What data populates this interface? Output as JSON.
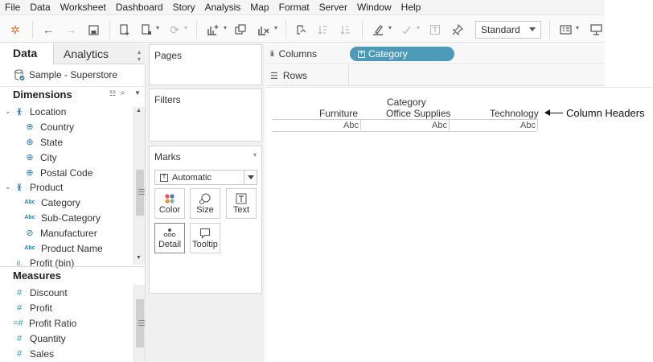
{
  "menu": [
    "File",
    "Data",
    "Worksheet",
    "Dashboard",
    "Story",
    "Analysis",
    "Map",
    "Format",
    "Server",
    "Window",
    "Help"
  ],
  "toolbar": {
    "fit_select": "Standard"
  },
  "left_pane": {
    "tabs": {
      "data": "Data",
      "analytics": "Analytics"
    },
    "datasource": "Sample - Superstore",
    "dimensions_title": "Dimensions",
    "dimensions": [
      {
        "label": "Location",
        "icon": "hierarchy-icon",
        "group": true
      },
      {
        "label": "Country",
        "icon": "globe-icon"
      },
      {
        "label": "State",
        "icon": "globe-icon"
      },
      {
        "label": "City",
        "icon": "globe-icon"
      },
      {
        "label": "Postal Code",
        "icon": "globe-icon"
      },
      {
        "label": "Product",
        "icon": "hierarchy-icon",
        "group": true
      },
      {
        "label": "Category",
        "icon": "abc-icon"
      },
      {
        "label": "Sub-Category",
        "icon": "abc-icon"
      },
      {
        "label": "Manufacturer",
        "icon": "link-icon"
      },
      {
        "label": "Product Name",
        "icon": "abc-icon"
      },
      {
        "label": "Profit (bin)",
        "icon": "bin-icon"
      }
    ],
    "measures_title": "Measures",
    "measures": [
      {
        "label": "Discount",
        "icon": "hash-icon"
      },
      {
        "label": "Profit",
        "icon": "hash-icon"
      },
      {
        "label": "Profit Ratio",
        "icon": "calc-hash-icon"
      },
      {
        "label": "Quantity",
        "icon": "hash-icon"
      },
      {
        "label": "Sales",
        "icon": "hash-icon"
      }
    ]
  },
  "cards": {
    "pages": "Pages",
    "filters": "Filters",
    "marks": "Marks",
    "marks_type": "Automatic",
    "mark_buttons": {
      "color": "Color",
      "size": "Size",
      "text": "Text",
      "detail": "Detail",
      "tooltip": "Tooltip"
    }
  },
  "shelves": {
    "columns": "Columns",
    "rows": "Rows",
    "columns_pill": "Category"
  },
  "view": {
    "field_header": "Category",
    "column_headers": [
      "Furniture",
      "Office Supplies",
      "Technology"
    ],
    "cells": [
      "Abc",
      "Abc",
      "Abc"
    ]
  },
  "annotation": "Column Headers",
  "colors": {
    "pill": "#4c99b8",
    "field_icon": "#2c7ab0",
    "measure_icon": "#2aa198"
  }
}
